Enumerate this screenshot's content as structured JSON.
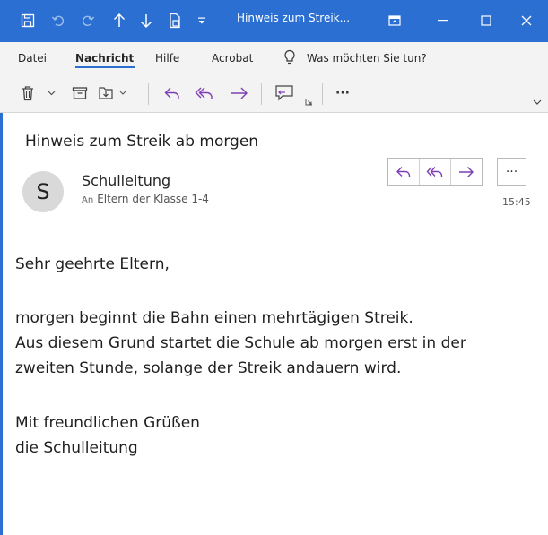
{
  "window": {
    "title": "Hinweis zum Streik...",
    "icons": [
      "save-icon",
      "undo-icon",
      "redo-icon",
      "arrow-up-icon",
      "arrow-down-icon",
      "page-icon",
      "customize-icon",
      "ribbon-display-icon",
      "minimize-icon",
      "maximize-icon",
      "close-icon"
    ]
  },
  "menu": {
    "items": [
      {
        "label": "Datei"
      },
      {
        "label": "Nachricht"
      },
      {
        "label": "Hilfe"
      },
      {
        "label": "Acrobat"
      }
    ],
    "search_label": "Was möchten Sie tun?"
  },
  "toolbar": {
    "more_label": "···"
  },
  "message": {
    "subject": "Hinweis zum Streik ab morgen",
    "avatar_initial": "S",
    "sender": "Schulleitung",
    "to_label": "An",
    "to": "Eltern der Klasse 1-4",
    "time": "15:45",
    "more_label": "···",
    "body": {
      "greeting": "Sehr geehrte Eltern,",
      "line1": "morgen beginnt die Bahn einen mehrtägigen Streik.",
      "line2": "Aus diesem Grund startet die Schule ab morgen erst in der",
      "line3": "zweiten Stunde, solange der Streik andauern wird.",
      "closing": "Mit freundlichen Grüßen",
      "signature": "die Schulleitung"
    }
  },
  "colors": {
    "accent": "#2b6fd2",
    "action_purple": "#7e3fb4"
  }
}
